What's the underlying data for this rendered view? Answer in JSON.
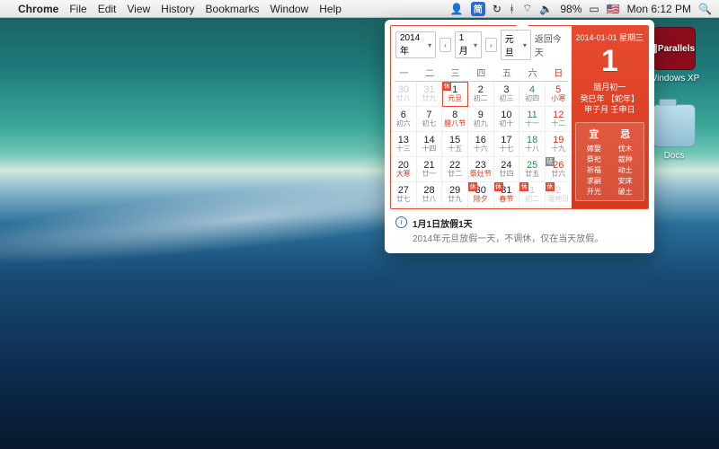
{
  "menubar": {
    "apple": "",
    "app": "Chrome",
    "items": [
      "File",
      "Edit",
      "View",
      "History",
      "Bookmarks",
      "Window",
      "Help"
    ],
    "right": {
      "user": "👤",
      "cal": "简",
      "clock_ico": "↻",
      "bt": "ᚼ",
      "wifi": "⌔",
      "vol": "🔈",
      "batt_pct": "98%",
      "batt": "▭",
      "flag": "🇺🇸",
      "time": "Mon 6:12 PM",
      "spot": "🔍"
    }
  },
  "desktop": {
    "parallels": {
      "name": "∥Parallels",
      "label": "Windows XP"
    },
    "docs": {
      "label": "Docs"
    }
  },
  "calendar": {
    "header": {
      "year": "2014年",
      "month": "1月",
      "holiday": "元旦",
      "today": "返回今天"
    },
    "weekdays": [
      "一",
      "二",
      "三",
      "四",
      "五",
      "六",
      "日"
    ],
    "cells": [
      {
        "d": "30",
        "s": "廿八",
        "other": true
      },
      {
        "d": "31",
        "s": "廿九",
        "other": true
      },
      {
        "d": "1",
        "s": "元旦",
        "today": true,
        "special": true,
        "badge": "休"
      },
      {
        "d": "2",
        "s": "初二"
      },
      {
        "d": "3",
        "s": "初三"
      },
      {
        "d": "4",
        "s": "初四",
        "sat": true
      },
      {
        "d": "5",
        "s": "小寒",
        "sun": true,
        "special": true
      },
      {
        "d": "6",
        "s": "初六"
      },
      {
        "d": "7",
        "s": "初七"
      },
      {
        "d": "8",
        "s": "腊八节",
        "special": true
      },
      {
        "d": "9",
        "s": "初九"
      },
      {
        "d": "10",
        "s": "初十"
      },
      {
        "d": "11",
        "s": "十一",
        "sat": true
      },
      {
        "d": "12",
        "s": "十二",
        "sun": true
      },
      {
        "d": "13",
        "s": "十三"
      },
      {
        "d": "14",
        "s": "十四"
      },
      {
        "d": "15",
        "s": "十五"
      },
      {
        "d": "16",
        "s": "十六"
      },
      {
        "d": "17",
        "s": "十七"
      },
      {
        "d": "18",
        "s": "十八",
        "sat": true
      },
      {
        "d": "19",
        "s": "十九",
        "sun": true
      },
      {
        "d": "20",
        "s": "大寒",
        "special": true
      },
      {
        "d": "21",
        "s": "廿一"
      },
      {
        "d": "22",
        "s": "廿二"
      },
      {
        "d": "23",
        "s": "祭灶节",
        "special": true
      },
      {
        "d": "24",
        "s": "廿四"
      },
      {
        "d": "25",
        "s": "廿五",
        "sat": true
      },
      {
        "d": "26",
        "s": "廿六",
        "sun": true,
        "badge": "班"
      },
      {
        "d": "27",
        "s": "廿七"
      },
      {
        "d": "28",
        "s": "廿八"
      },
      {
        "d": "29",
        "s": "廿九"
      },
      {
        "d": "30",
        "s": "除夕",
        "special": true,
        "badge": "休"
      },
      {
        "d": "31",
        "s": "春节",
        "special": true,
        "badge": "休"
      },
      {
        "d": "1",
        "s": "初二",
        "other": true,
        "badge": "休"
      },
      {
        "d": "2",
        "s": "湿地日",
        "other": true,
        "badge": "休"
      }
    ],
    "side": {
      "date_line": "2014-01-01 星期三",
      "big": "1",
      "lunar": [
        "腊月初一",
        "癸巳年 【蛇年】",
        "甲子月 壬申日"
      ],
      "yi": {
        "title": "宜",
        "items": [
          "嫁娶",
          "祭祀",
          "祈福",
          "求嗣",
          "开光"
        ]
      },
      "ji": {
        "title": "忌",
        "items": [
          "伐木",
          "栽种",
          "动土",
          "安床",
          "破土"
        ]
      }
    },
    "note": {
      "title": "1月1日放假1天",
      "body": "2014年元旦放假一天，不调休，仅在当天放假。"
    }
  }
}
